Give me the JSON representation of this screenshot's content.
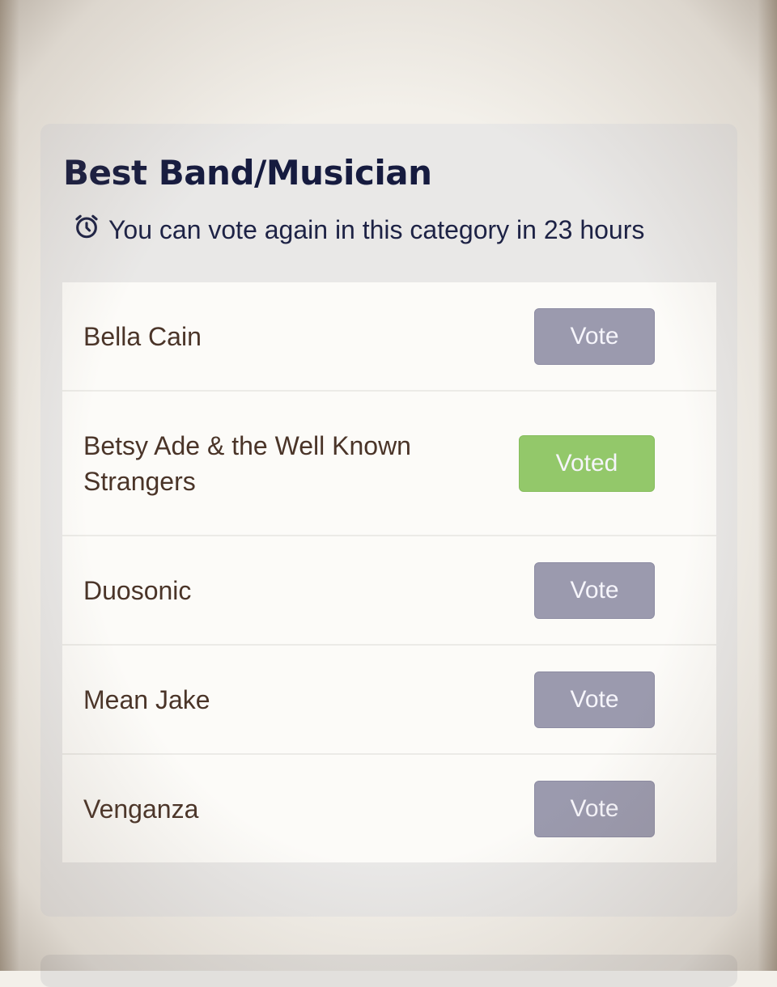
{
  "category": {
    "title": "Best Band/Musician",
    "notice": "You can vote again in this category in 23 hours",
    "notice_icon": "alarm-clock-icon"
  },
  "nominees": [
    {
      "name": "Bella Cain",
      "button": "Vote",
      "voted": false
    },
    {
      "name": "Betsy Ade & the Well Known Strangers",
      "button": "Voted",
      "voted": true
    },
    {
      "name": "Duosonic",
      "button": "Vote",
      "voted": false
    },
    {
      "name": "Mean Jake",
      "button": "Vote",
      "voted": false
    },
    {
      "name": "Venganza",
      "button": "Vote",
      "voted": false
    }
  ],
  "colors": {
    "title": "#161b3f",
    "vote_button": "#9b9aae",
    "voted_button": "#93c86a",
    "nominee_text": "#4a3428",
    "card_background": "#e9e8e7",
    "list_background": "#fcfbf8"
  }
}
